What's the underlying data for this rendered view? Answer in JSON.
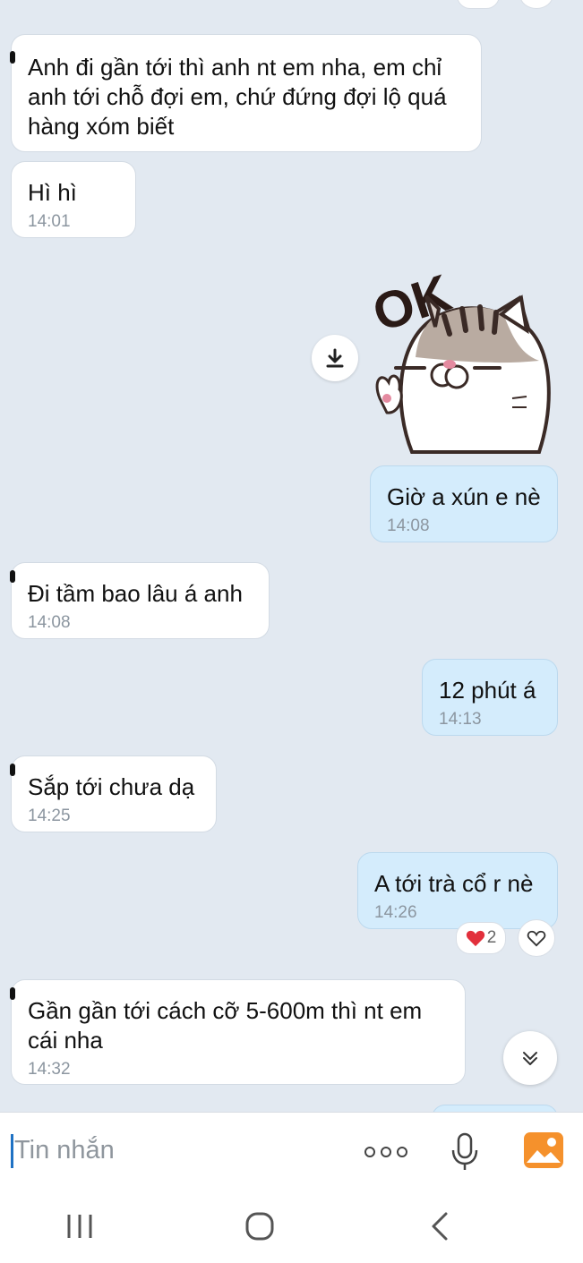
{
  "messages": [
    {
      "text": "Anh đi gần tới thì anh nt em nha, em chỉ anh tới chỗ đợi em, chứ đứng đợi lộ quá hàng xóm biết",
      "time": ""
    },
    {
      "text": "Hì hì",
      "time": "14:01"
    },
    {
      "text": "Giờ a xún e nè",
      "time": "14:08"
    },
    {
      "text": "Đi tầm bao lâu á anh",
      "time": "14:08"
    },
    {
      "text": "12 phút á",
      "time": "14:13"
    },
    {
      "text": "Sắp tới chưa dạ",
      "time": "14:25"
    },
    {
      "text": "A tới trà cổ r nè",
      "time": "14:26"
    },
    {
      "text": "Gần gần tới cách cỡ 5-600m thì nt em cái nha",
      "time": "14:32"
    }
  ],
  "sticker": {
    "text": "OK"
  },
  "reaction": {
    "count": "2"
  },
  "composer": {
    "placeholder": "Tin nhắn"
  },
  "icons": [
    "download-icon",
    "heart-icon",
    "scroll-down-icon",
    "more-icon",
    "microphone-icon",
    "image-icon",
    "recent-apps-icon",
    "home-icon",
    "back-icon"
  ],
  "colors": {
    "background": "#e2e9f1",
    "outgoing": "#d4ecfc",
    "incoming": "#ffffff",
    "accent": "#f5912c"
  }
}
